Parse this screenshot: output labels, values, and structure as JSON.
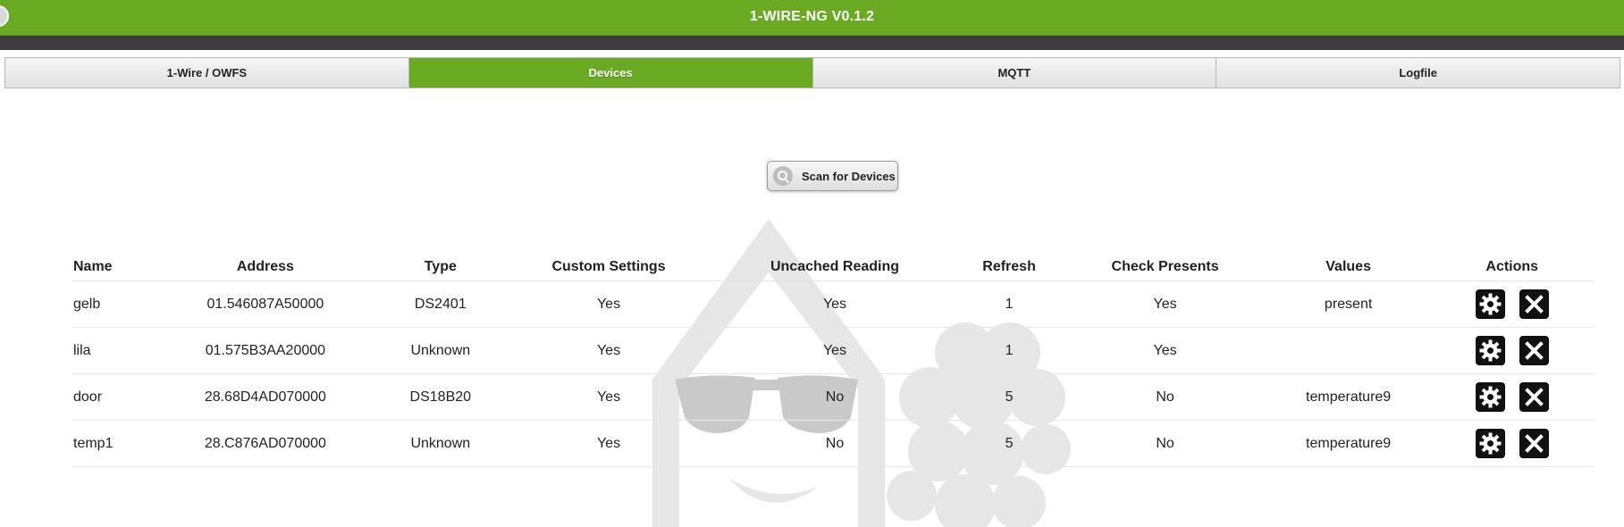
{
  "app": {
    "title": "1-WIRE-NG V0.1.2"
  },
  "tabs": [
    {
      "label": "1-Wire / OWFS",
      "active": false
    },
    {
      "label": "Devices",
      "active": true
    },
    {
      "label": "MQTT",
      "active": false
    },
    {
      "label": "Logfile",
      "active": false
    }
  ],
  "scan": {
    "label": "Scan for Devices",
    "icon": "search-icon"
  },
  "table": {
    "headers": [
      "Name",
      "Address",
      "Type",
      "Custom Settings",
      "Uncached Reading",
      "Refresh",
      "Check Presents",
      "Values",
      "Actions"
    ],
    "rows": [
      {
        "name": "gelb",
        "address": "01.546087A50000",
        "type": "DS2401",
        "custom": "Yes",
        "uncached": "Yes",
        "refresh": "1",
        "check": "Yes",
        "values": "present"
      },
      {
        "name": "lila",
        "address": "01.575B3AA20000",
        "type": "Unknown",
        "custom": "Yes",
        "uncached": "Yes",
        "refresh": "1",
        "check": "Yes",
        "values": ""
      },
      {
        "name": "door",
        "address": "28.68D4AD070000",
        "type": "DS18B20",
        "custom": "Yes",
        "uncached": "No",
        "refresh": "5",
        "check": "No",
        "values": "temperature9"
      },
      {
        "name": "temp1",
        "address": "28.C876AD070000",
        "type": "Unknown",
        "custom": "Yes",
        "uncached": "No",
        "refresh": "5",
        "check": "No",
        "values": "temperature9"
      }
    ],
    "action_icons": [
      "gear-icon",
      "close-icon"
    ]
  },
  "colors": {
    "accent": "#6aaa23",
    "darkbar": "#3c3c3c",
    "watermark": "#e6e6e6"
  }
}
